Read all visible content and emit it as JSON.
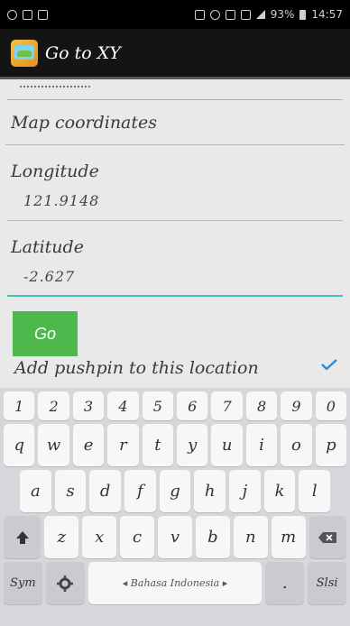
{
  "status_bar": {
    "time": "14:57",
    "battery_percent": "93%"
  },
  "action_bar": {
    "title": "Go to XY"
  },
  "form": {
    "section_title": "Map coordinates",
    "longitude_label": "Longitude",
    "longitude_value": "121.9148",
    "latitude_label": "Latitude",
    "latitude_value": "-2.627",
    "go_label": "Go",
    "pushpin_label": "Add pushpin to this location",
    "pushpin_checked": true
  },
  "keyboard": {
    "number_row": [
      "1",
      "2",
      "3",
      "4",
      "5",
      "6",
      "7",
      "8",
      "9",
      "0"
    ],
    "row1": [
      "q",
      "w",
      "e",
      "r",
      "t",
      "y",
      "u",
      "i",
      "o",
      "p"
    ],
    "row2": [
      "a",
      "s",
      "d",
      "f",
      "g",
      "h",
      "j",
      "k",
      "l"
    ],
    "row3": [
      "z",
      "x",
      "c",
      "v",
      "b",
      "n",
      "m"
    ],
    "sym_label": "Sym",
    "space_label": "◂ Bahasa Indonesia ▸",
    "period_label": ".",
    "enter_label": "Slsi"
  },
  "colors": {
    "accent": "#41c6b6",
    "go_button": "#4fb84c",
    "check": "#2f8ad8"
  }
}
